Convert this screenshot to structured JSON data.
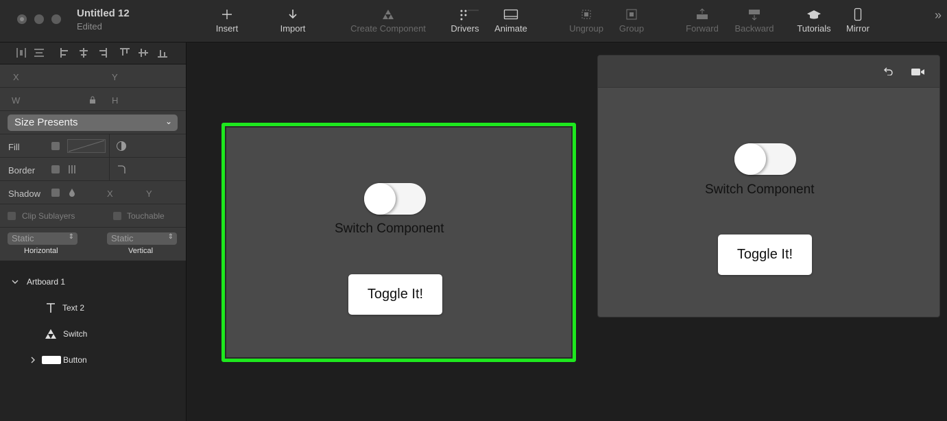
{
  "window": {
    "title": "Untitled 12",
    "subtitle": "Edited"
  },
  "toolbar": {
    "items": [
      {
        "label": "Insert",
        "icon": "plus-icon",
        "enabled": true
      },
      {
        "label": "Import",
        "icon": "arrow-down-icon",
        "enabled": true
      },
      {
        "label": "Create Component",
        "icon": "component-icon",
        "enabled": false
      },
      {
        "label": "Drivers",
        "icon": "drivers-icon",
        "enabled": true
      },
      {
        "label": "Animate",
        "icon": "animate-icon",
        "enabled": true
      },
      {
        "label": "Ungroup",
        "icon": "ungroup-icon",
        "enabled": false
      },
      {
        "label": "Group",
        "icon": "group-icon",
        "enabled": false
      },
      {
        "label": "Forward",
        "icon": "forward-icon",
        "enabled": false
      },
      {
        "label": "Backward",
        "icon": "backward-icon",
        "enabled": false
      },
      {
        "label": "Tutorials",
        "icon": "graduation-cap-icon",
        "enabled": true
      },
      {
        "label": "Mirror",
        "icon": "phone-icon",
        "enabled": true
      }
    ],
    "overflow": "»"
  },
  "inspector": {
    "x_label": "X",
    "y_label": "Y",
    "w_label": "W",
    "h_label": "H",
    "size_presets": "Size Presents",
    "fill_label": "Fill",
    "border_label": "Border",
    "shadow_label": "Shadow",
    "shadow_x": "X",
    "shadow_y": "Y",
    "clip_sublayers": "Clip Sublayers",
    "touchable": "Touchable",
    "horizontal_value": "Static",
    "vertical_value": "Static",
    "horizontal_label": "Horizontal",
    "vertical_label": "Vertical"
  },
  "layers": [
    {
      "name": "Artboard 1",
      "icon": "chevron-down-icon"
    },
    {
      "name": "Text 2",
      "icon": "text-icon"
    },
    {
      "name": "Switch",
      "icon": "component-icon"
    },
    {
      "name": "Button",
      "icon": "rectangle-icon"
    }
  ],
  "canvas": {
    "switch_label": "Switch Component",
    "button_label": "Toggle It!",
    "highlight_color": "#1ee81e"
  },
  "preview": {
    "switch_label": "Switch Component",
    "button_label": "Toggle It!"
  }
}
